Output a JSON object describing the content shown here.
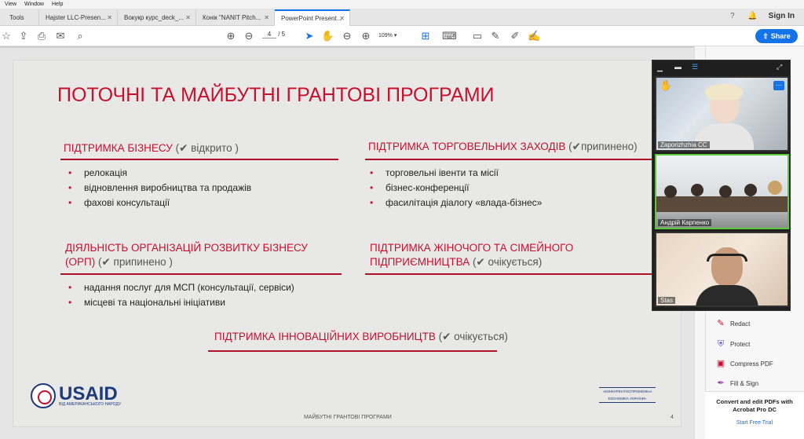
{
  "menu": [
    "View",
    "Window",
    "Help"
  ],
  "tabs": [
    {
      "label": "Tools"
    },
    {
      "label": "Hajster LLC-Presen..."
    },
    {
      "label": "Вокукр курс_deck_..."
    },
    {
      "label": "Конік \"NANIT Pitch..."
    },
    {
      "label": "PowerPoint Present..."
    }
  ],
  "header": {
    "signin": "Sign In"
  },
  "toolbar": {
    "page_current": "4",
    "page_total": "/ 5",
    "zoom": "109%",
    "share": "Share"
  },
  "slide": {
    "title": "ПОТОЧНІ ТА МАЙБУТНІ ГРАНТОВІ ПРОГРАМИ",
    "s1": {
      "h": "ПІДТРИМКА БІЗНЕСУ",
      "st": "(✔ відкрито )",
      "items": [
        "релокація",
        "відновлення виробництва та продажів",
        "фахові консультації"
      ]
    },
    "s2": {
      "h": "ПІДТРИМКА ТОРГОВЕЛЬНИХ ЗАХОДІВ",
      "st": "(✔припинено)",
      "items": [
        "торговельні івенти та місії",
        "бізнес-конференції",
        "фасилітація діалогу «влада-бізнес»"
      ]
    },
    "s3": {
      "h1": "ДІЯЛЬНІСТЬ ОРГАНІЗАЦІЙ РОЗВИТКУ БІЗНЕСУ",
      "h2": "(ОРП)",
      "st": "(✔ припинено )",
      "items": [
        "надання послуг для МСП (консультації, сервіси)",
        "місцеві та національні ініціативи"
      ]
    },
    "s4": {
      "h1": "ПІДТРИМКА ЖІНОЧОГО ТА СІМЕЙНОГО",
      "h2": "ПІДПРИЄМНИЦТВА",
      "st": "(✔ очікується)"
    },
    "s5": {
      "h": "ПІДТРИМКА ІННОВАЦІЙНИХ ВИРОБНИЦТВ",
      "st": "(✔ очікується)"
    },
    "usaid": "USAID",
    "usaid_sub": "ВІД АМЕРИКАНСЬКОГО НАРОДУ",
    "logo2": "«КОНКУРЕНТОСПРОМОЖНА ЕКОНОМІКА УКРАЇНИ»",
    "footer": "МАЙБУТНІ ГРАНТОВІ ПРОГРАМИ",
    "page": "4"
  },
  "video": [
    {
      "name": "Zaporizhzhia CC"
    },
    {
      "name": "Андрій Карпенко"
    },
    {
      "name": "Stas"
    }
  ],
  "tools": [
    {
      "label": "Redact",
      "icon": "redact-icon"
    },
    {
      "label": "Protect",
      "icon": "shield-icon"
    },
    {
      "label": "Compress PDF",
      "icon": "compress-icon"
    },
    {
      "label": "Fill & Sign",
      "icon": "pen-icon"
    }
  ],
  "promo": {
    "text": "Convert and edit PDFs with Acrobat Pro DC",
    "link": "Start Free Trial"
  }
}
